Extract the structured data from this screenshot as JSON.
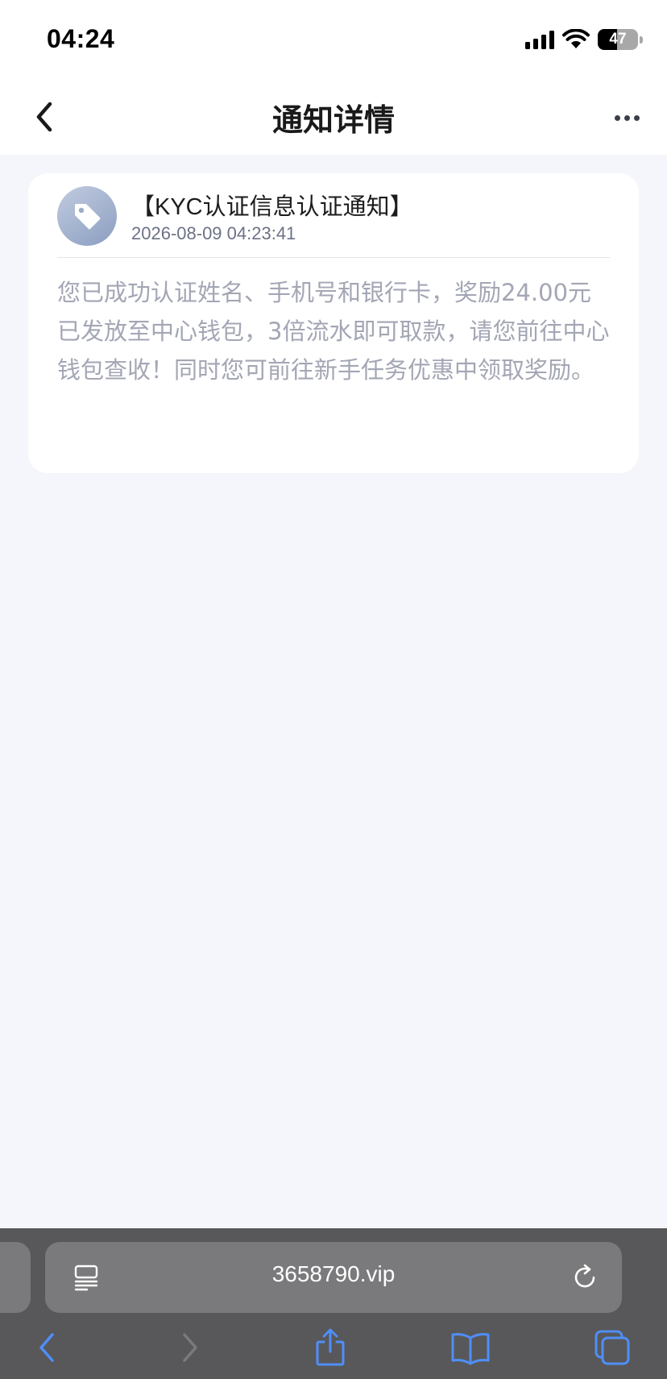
{
  "status_bar": {
    "time": "04:24",
    "battery_level": "47",
    "icons": [
      "cellular-signal-icon",
      "wifi-icon",
      "battery-icon"
    ]
  },
  "nav": {
    "title": "通知详情",
    "icons": [
      "chevron-left-icon",
      "more-dots-icon"
    ]
  },
  "notification": {
    "icon": "tag-icon",
    "title": "【KYC认证信息认证通知】",
    "timestamp": "2026-08-09 04:23:41",
    "body": "您已成功认证姓名、手机号和银行卡，奖励24.00元已发放至中心钱包，3倍流水即可取款，请您前往中心钱包查收！同时您可前往新手任务优惠中领取奖励。"
  },
  "browser": {
    "url": "3658790.vip",
    "toolbar_icons": [
      "back-icon",
      "forward-icon",
      "share-icon",
      "bookmarks-icon",
      "tabs-icon"
    ],
    "accent_color": "#4f8ef7"
  }
}
